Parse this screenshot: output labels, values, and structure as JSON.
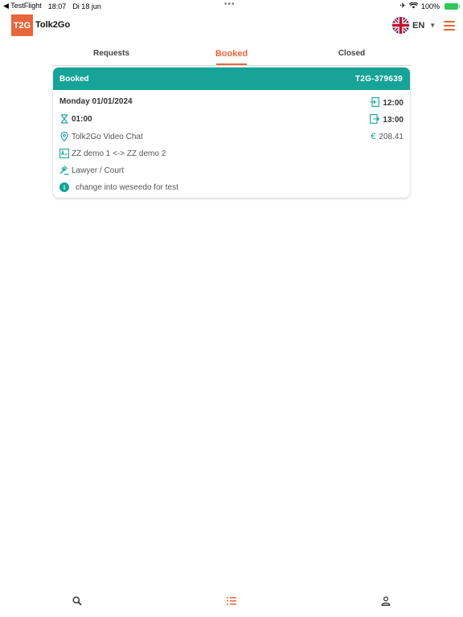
{
  "statusbar": {
    "back_app": "◀ TestFlight",
    "time": "18:07",
    "date": "Di 18 jun",
    "dots": "•••",
    "battery": "100%"
  },
  "header": {
    "logo_mark": "T2G",
    "logo_text": "Tolk2Go",
    "language": "EN"
  },
  "tabs": [
    {
      "label": "Requests"
    },
    {
      "label": "Booked"
    },
    {
      "label": "Closed"
    }
  ],
  "active_tab": "Booked",
  "booking": {
    "status": "Booked",
    "id": "T2G-379639",
    "date": "Monday 01/01/2024",
    "duration": "01:00",
    "location": "Tolk2Go Video Chat",
    "languages": "ZZ demo 1 <-> ZZ demo 2",
    "sector": "Lawyer / Court",
    "note": "change into weseedo for test",
    "start_time": "12:00",
    "end_time": "13:00",
    "currency": "€",
    "price": "208.41"
  },
  "colors": {
    "brand_orange": "#e8663b",
    "teal": "#17a398"
  },
  "icons": {
    "search": "search-icon",
    "list": "list-icon",
    "profile": "profile-icon"
  }
}
